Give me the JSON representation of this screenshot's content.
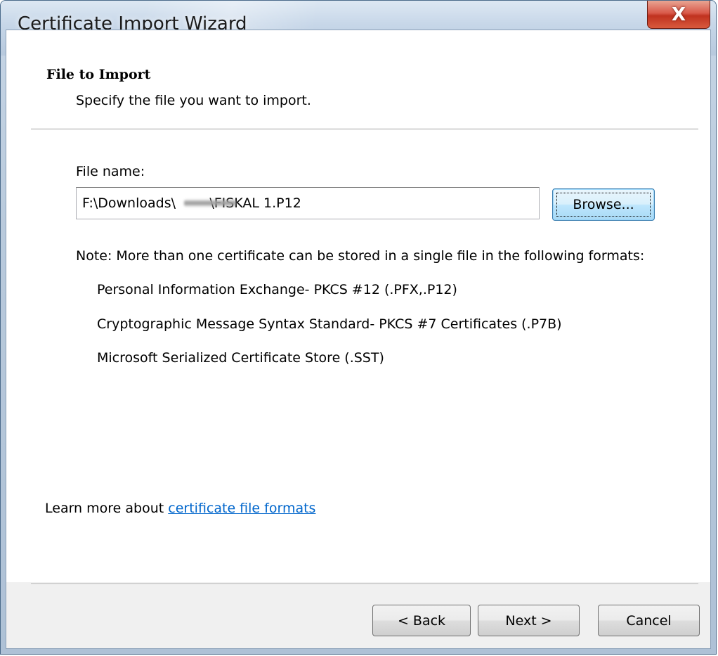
{
  "window": {
    "title": "Certificate Import Wizard",
    "close_glyph": "X"
  },
  "header": {
    "section_title": "File to Import",
    "section_subtitle": "Specify the file you want to import."
  },
  "file": {
    "label": "File name:",
    "value": "F:\\Downloads\\        \\FISKAL 1.P12",
    "browse_label": "Browse..."
  },
  "note": {
    "text": "Note:  More than one certificate can be stored in a single file in the following formats:",
    "formats": [
      "Personal Information Exchange- PKCS #12 (.PFX,.P12)",
      "Cryptographic Message Syntax Standard- PKCS #7 Certificates (.P7B)",
      "Microsoft Serialized Certificate Store (.SST)"
    ]
  },
  "learn_more": {
    "prefix": "Learn more about ",
    "link_text": "certificate file formats"
  },
  "footer": {
    "back_label": "< Back",
    "next_label": "Next >",
    "cancel_label": "Cancel"
  },
  "colors": {
    "link": "#0066cc",
    "close_button": "#c0321f",
    "title_bar": "#c6d6e8"
  }
}
